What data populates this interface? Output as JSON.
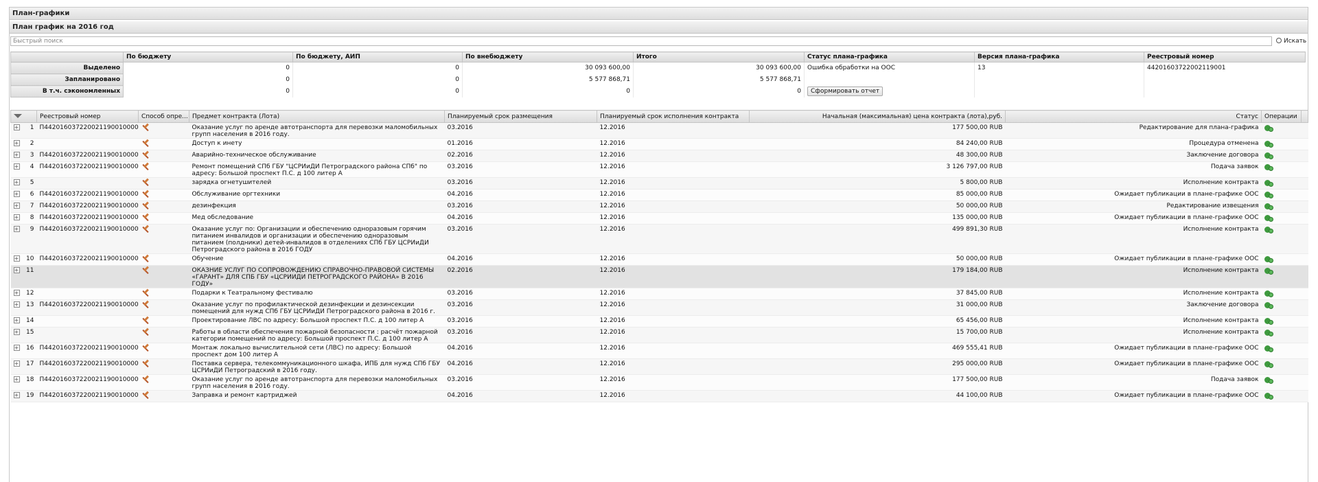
{
  "page": {
    "title": "План-графики",
    "subtitle": "План график на 2016 год"
  },
  "search": {
    "placeholder": "Быстрый поиск",
    "button_label": "Искать",
    "button_icon": "magnifier-icon"
  },
  "summary": {
    "headers": [
      "По бюджету",
      "По бюджету, АИП",
      "По внебюджету",
      "Итого",
      "Статус плана-графика",
      "Версия плана-графика",
      "Реестровый номер"
    ],
    "rows": [
      {
        "label": "Выделено",
        "values": [
          "0",
          "0",
          "30 093 600,00",
          "30 093 600,00"
        ],
        "status": "Ошибка обработки на ООС",
        "version": "13",
        "reg": "44201603722002119001"
      },
      {
        "label": "Запланировано",
        "values": [
          "0",
          "0",
          "5 577 868,71",
          "5 577 868,71"
        ]
      },
      {
        "label": "В т.ч. сэкономленных",
        "values": [
          "0",
          "0",
          "0",
          "0"
        ],
        "report_button": "Сформировать отчет"
      }
    ]
  },
  "grid": {
    "columns": [
      "Реестровый номер",
      "Способ опре...",
      "Предмет контракта (Лота)",
      "Планируемый срок размещения",
      "Планируемый срок исполнения контракта",
      "Начальная (максимальная) цена контракта (лота),руб.",
      "Статус",
      "Операции"
    ],
    "rows": [
      {
        "n": "1",
        "reg": "П44201603722002119001000026",
        "subject": "Оказание услуг по аренде автотранспорта для перевозки маломобильных групп населения в 2016 году.",
        "place": "03.2016",
        "exec": "12.2016",
        "price": "177 500,00 RUB",
        "status": "Редактирование для плана-графика"
      },
      {
        "n": "2",
        "reg": "",
        "subject": "Доступ к инету",
        "place": "01.2016",
        "exec": "12.2016",
        "price": "84 240,00 RUB",
        "status": "Процедура отменена"
      },
      {
        "n": "3",
        "reg": "П44201603722002119001000007",
        "subject": "Аварийно-техническое обслуживание",
        "place": "02.2016",
        "exec": "12.2016",
        "price": "48 300,00 RUB",
        "status": "Заключение договора"
      },
      {
        "n": "4",
        "reg": "П44201603722002119001000006",
        "subject": "Ремонт помещений СПб ГБУ \"ЦСРИиДИ Петроградского района СПб\" по адресу: Большой проспект П.С. д 100 литер А",
        "place": "03.2016",
        "exec": "12.2016",
        "price": "3 126 797,00 RUB",
        "status": "Подача заявок"
      },
      {
        "n": "5",
        "reg": "",
        "subject": "зарядка огнетушителей",
        "place": "03.2016",
        "exec": "12.2016",
        "price": "5 800,00 RUB",
        "status": "Исполнение контракта"
      },
      {
        "n": "6",
        "reg": "П44201603722002119001000005",
        "subject": "Обслуживание оргтехники",
        "place": "04.2016",
        "exec": "12.2016",
        "price": "85 000,00 RUB",
        "status": "Ожидает публикации в плане-графике ООС"
      },
      {
        "n": "7",
        "reg": "П44201603722002119001000004",
        "subject": "дезинфекция",
        "place": "03.2016",
        "exec": "12.2016",
        "price": "50 000,00 RUB",
        "status": "Редактирование извещения"
      },
      {
        "n": "8",
        "reg": "П44201603722002119001000003",
        "subject": "Мед обследование",
        "place": "04.2016",
        "exec": "12.2016",
        "price": "135 000,00 RUB",
        "status": "Ожидает публикации в плане-графике ООС"
      },
      {
        "n": "9",
        "reg": "П44201603722002119001000002",
        "subject": "Оказание услуг по: Организации и обеспечению одноразовым горячим питанием инвалидов и организации и обеспечению одноразовым питанием (полдники) детей-инвалидов в отделениях СПб ГБУ ЦСРИиДИ Петроградского района в 2016 ГОДУ",
        "place": "03.2016",
        "exec": "12.2016",
        "price": "499 891,30 RUB",
        "status": "Исполнение контракта"
      },
      {
        "n": "10",
        "reg": "П44201603722002119001000001",
        "subject": "Обучение",
        "place": "04.2016",
        "exec": "12.2016",
        "price": "50 000,00 RUB",
        "status": "Ожидает публикации в плане-графике ООС"
      },
      {
        "n": "11",
        "reg": "",
        "subject": "ОКАЗНИЕ УСЛУГ ПО СОПРОВОЖДЕНИЮ СПРАВОЧНО-ПРАВОВОЙ СИСТЕМЫ «ГАРАНТ» ДЛЯ СПБ ГБУ «ЦСРИИДИ ПЕТРОГРАДСКОГО РАЙОНА» В 2016 ГОДУ»",
        "place": "02.2016",
        "exec": "12.2016",
        "price": "179 184,00 RUB",
        "status": "Исполнение контракта",
        "selected": true
      },
      {
        "n": "12",
        "reg": "",
        "subject": "Подарки к Театральному фестивалю",
        "place": "03.2016",
        "exec": "12.2016",
        "price": "37 845,00 RUB",
        "status": "Исполнение контракта"
      },
      {
        "n": "13",
        "reg": "П44201603722002119001000008",
        "subject": "Оказание услуг по профилактической дезинфекции и дезинсекции помещений для нужд СПб ГБУ ЦСРИиДИ Петроградского района в 2016 г.",
        "place": "03.2016",
        "exec": "12.2016",
        "price": "31 000,00 RUB",
        "status": "Заключение договора"
      },
      {
        "n": "14",
        "reg": "",
        "subject": "Проектирование ЛВС по адресу: Большой проспект П.С. д 100 литер А",
        "place": "03.2016",
        "exec": "12.2016",
        "price": "65 456,00 RUB",
        "status": "Исполнение контракта"
      },
      {
        "n": "15",
        "reg": "",
        "subject": "Работы в области обеспечения пожарной безопасности : расчёт пожарной категории помещений по адресу: Большой проспект П.С. д 100 литер А",
        "place": "03.2016",
        "exec": "12.2016",
        "price": "15 700,00 RUB",
        "status": "Исполнение контракта"
      },
      {
        "n": "16",
        "reg": "П44201603722002119001000010",
        "subject": "Монтаж локально вычислительной сети (ЛВС) по адресу: Большой проспект дом 100 литер А",
        "place": "04.2016",
        "exec": "12.2016",
        "price": "469 555,41 RUB",
        "status": "Ожидает публикации в плане-графике ООС"
      },
      {
        "n": "17",
        "reg": "П44201603722002119001000009",
        "subject": "Поставка сервера, телекоммуникационного шкафа, ИПБ для нужд СПб ГБУ ЦСРИиДИ Петроградский в 2016 году.",
        "place": "04.2016",
        "exec": "12.2016",
        "price": "295 000,00 RUB",
        "status": "Ожидает публикации в плане-графике ООС"
      },
      {
        "n": "18",
        "reg": "П44201603722002119001000012",
        "subject": "Оказание услуг по аренде автотранспорта для перевозки маломобильных групп населения в 2016 году.",
        "place": "03.2016",
        "exec": "12.2016",
        "price": "177 500,00 RUB",
        "status": "Подача заявок"
      },
      {
        "n": "19",
        "reg": "П44201603722002119001000011",
        "subject": "Заправка и ремонт картриджей",
        "place": "04.2016",
        "exec": "12.2016",
        "price": "44 100,00 RUB",
        "status": "Ожидает публикации в плане-графике ООС"
      }
    ],
    "method_icon": "gavel-icon",
    "operation_icon": "gear-arrows-icon",
    "expand_symbol": "+",
    "filter_icon": "filter-icon"
  }
}
